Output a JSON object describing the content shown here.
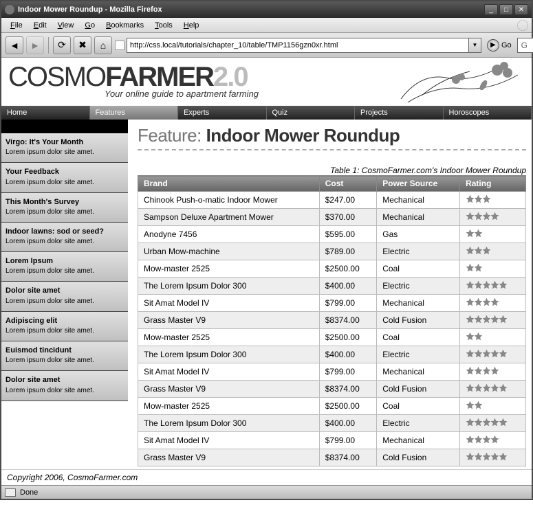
{
  "window": {
    "title": "Indoor Mower Roundup - Mozilla Firefox"
  },
  "menu": [
    "File",
    "Edit",
    "View",
    "Go",
    "Bookmarks",
    "Tools",
    "Help"
  ],
  "toolbar": {
    "url": "http://css.local/tutorials/chapter_10/table/TMP1156gzn0xr.html",
    "go_label": "Go"
  },
  "banner": {
    "logo_a": "COSMO",
    "logo_b": "FARMER",
    "logo_v": "2.0",
    "tagline": "Your online guide to apartment farming"
  },
  "nav": [
    {
      "label": "Home",
      "active": false
    },
    {
      "label": "Features",
      "active": true
    },
    {
      "label": "Experts",
      "active": false
    },
    {
      "label": "Quiz",
      "active": false
    },
    {
      "label": "Projects",
      "active": false
    },
    {
      "label": "Horoscopes",
      "active": false
    }
  ],
  "sidebar": [
    {
      "title": "Virgo: It's Your Month",
      "text": "Lorem ipsum dolor site amet."
    },
    {
      "title": "Your Feedback",
      "text": "Lorem ipsum dolor site amet."
    },
    {
      "title": "This Month's Survey",
      "text": "Lorem ipsum dolor site amet."
    },
    {
      "title": "Indoor lawns: sod or seed?",
      "text": "Lorem ipsum dolor site amet."
    },
    {
      "title": "Lorem Ipsum",
      "text": "Lorem ipsum dolor site amet."
    },
    {
      "title": "Dolor site amet",
      "text": "Lorem ipsum dolor site amet."
    },
    {
      "title": "Adipiscing elit",
      "text": "Lorem ipsum dolor site amet."
    },
    {
      "title": "Euismod tincidunt",
      "text": "Lorem ipsum dolor site amet."
    },
    {
      "title": "Dolor site amet",
      "text": "Lorem ipsum dolor site amet."
    }
  ],
  "heading_pre": "Feature: ",
  "heading_bold": "Indoor Mower Roundup",
  "table_caption": "Table 1: CosmoFarmer.com's Indoor Mower Roundup",
  "headers": [
    "Brand",
    "Cost",
    "Power Source",
    "Rating"
  ],
  "rows": [
    {
      "brand": "Chinook Push-o-matic Indoor Mower",
      "cost": "$247.00",
      "power": "Mechanical",
      "rating": 3
    },
    {
      "brand": "Sampson Deluxe Apartment Mower",
      "cost": "$370.00",
      "power": "Mechanical",
      "rating": 4
    },
    {
      "brand": "Anodyne 7456",
      "cost": "$595.00",
      "power": "Gas",
      "rating": 2
    },
    {
      "brand": "Urban Mow-machine",
      "cost": "$789.00",
      "power": "Electric",
      "rating": 3
    },
    {
      "brand": "Mow-master 2525",
      "cost": "$2500.00",
      "power": "Coal",
      "rating": 2
    },
    {
      "brand": "The Lorem Ipsum Dolor 300",
      "cost": "$400.00",
      "power": "Electric",
      "rating": 5
    },
    {
      "brand": "Sit Amat Model IV",
      "cost": "$799.00",
      "power": "Mechanical",
      "rating": 4
    },
    {
      "brand": "Grass Master V9",
      "cost": "$8374.00",
      "power": "Cold Fusion",
      "rating": 5
    },
    {
      "brand": "Mow-master 2525",
      "cost": "$2500.00",
      "power": "Coal",
      "rating": 2
    },
    {
      "brand": "The Lorem Ipsum Dolor 300",
      "cost": "$400.00",
      "power": "Electric",
      "rating": 5
    },
    {
      "brand": "Sit Amat Model IV",
      "cost": "$799.00",
      "power": "Mechanical",
      "rating": 4
    },
    {
      "brand": "Grass Master V9",
      "cost": "$8374.00",
      "power": "Cold Fusion",
      "rating": 5
    },
    {
      "brand": "Mow-master 2525",
      "cost": "$2500.00",
      "power": "Coal",
      "rating": 2
    },
    {
      "brand": "The Lorem Ipsum Dolor 300",
      "cost": "$400.00",
      "power": "Electric",
      "rating": 5
    },
    {
      "brand": "Sit Amat Model IV",
      "cost": "$799.00",
      "power": "Mechanical",
      "rating": 4
    },
    {
      "brand": "Grass Master V9",
      "cost": "$8374.00",
      "power": "Cold Fusion",
      "rating": 5
    }
  ],
  "footer": "Copyright 2006, CosmoFarmer.com",
  "status": "Done"
}
